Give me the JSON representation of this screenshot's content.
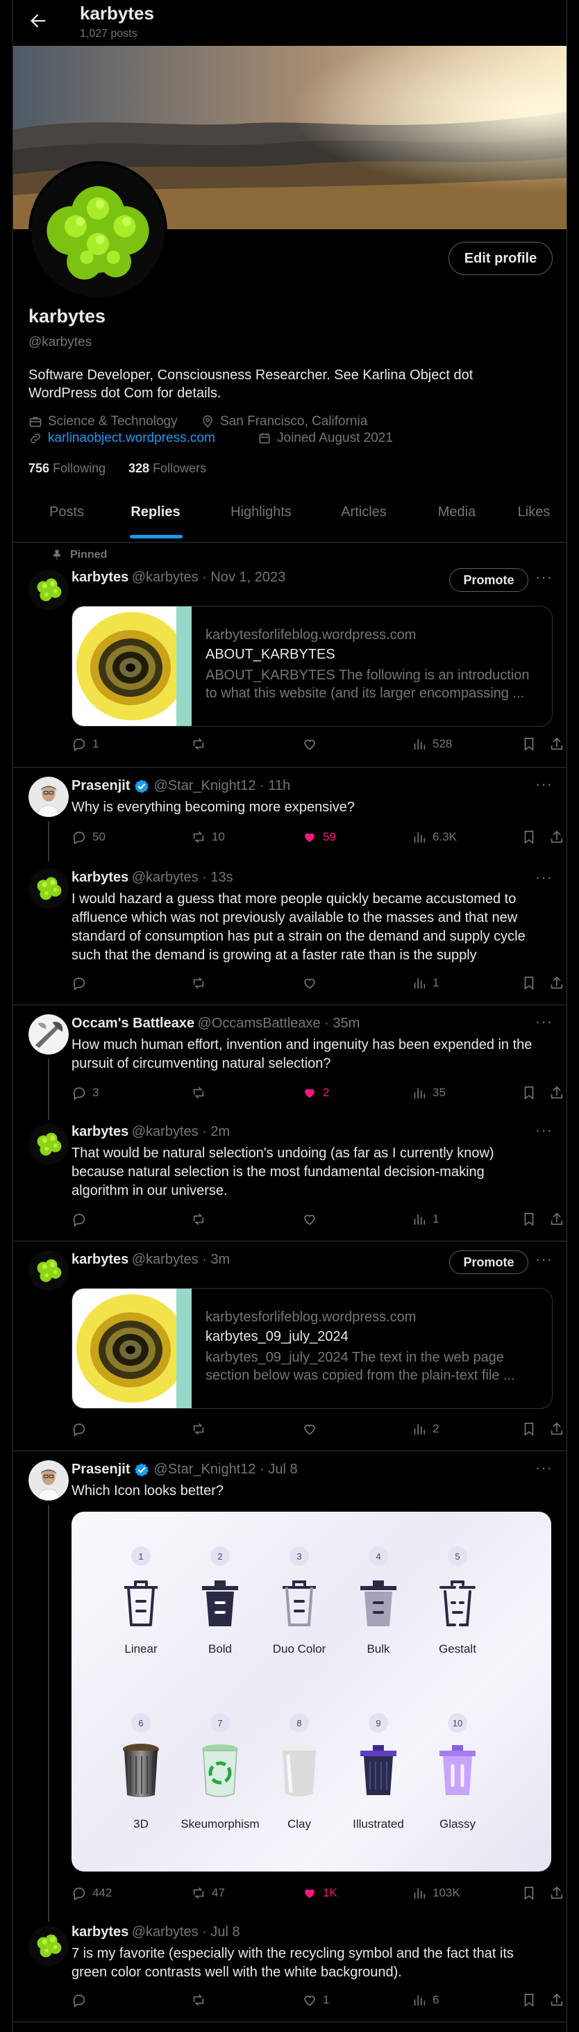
{
  "header": {
    "title": "karbytes",
    "subtitle": "1,027 posts"
  },
  "profile": {
    "name": "karbytes",
    "handle": "@karbytes",
    "edit_label": "Edit profile",
    "bio_line1": "Software Developer, Consciousness Researcher. See Karlina Object dot",
    "bio_line2": "WordPress dot Com for details.",
    "category": "Science & Technology",
    "location": "San Francisco, California",
    "website": "karlinaobject.wordpress.com",
    "joined": "Joined August 2021",
    "following_count": "756",
    "following_label": "Following",
    "followers_count": "328",
    "followers_label": "Followers"
  },
  "tabs": [
    "Posts",
    "Replies",
    "Highlights",
    "Articles",
    "Media",
    "Likes"
  ],
  "active_tab": "Replies",
  "colors": {
    "accent": "#1d9bf0",
    "like": "#f91880",
    "background": "#000000",
    "border": "#2f3336"
  },
  "posts": {
    "pinned": {
      "pinned_label": "Pinned",
      "name": "karbytes",
      "meta": "@karbytes · Nov 1, 2023",
      "promote": "Promote",
      "card_domain": "karbytesforlifeblog.wordpress.com",
      "card_title": "ABOUT_KARBYTES",
      "card_desc1": "ABOUT_KARBYTES The following is an introduction",
      "card_desc2": "to what this website (and its larger encompassing ...",
      "replies": "1",
      "views": "528"
    },
    "p1": {
      "name": "Prasenjit",
      "meta": "@Star_Knight12 · 11h",
      "text": "Why is everything becoming more expensive?",
      "replies": "50",
      "reposts": "10",
      "likes": "59",
      "views": "6.3K"
    },
    "r1": {
      "name": "karbytes",
      "meta": "@karbytes · 13s",
      "line1": "I would hazard a guess that more people quickly became accustomed to",
      "line2": "affluence which was not previously available to the masses and that new",
      "line3": "standard of consumption has put a strain on the demand and supply cycle",
      "line4": "such that the demand is growing at a faster rate than is the supply",
      "views": "1"
    },
    "p2": {
      "name": "Occam's Battleaxe",
      "meta": "@OccamsBattleaxe · 35m",
      "line1": "How much human effort, invention and ingenuity has been expended in the",
      "line2": "pursuit of circumventing natural selection?",
      "replies": "3",
      "likes": "2",
      "views": "35"
    },
    "r2": {
      "name": "karbytes",
      "meta": "@karbytes · 2m",
      "line1": "That would be natural selection's undoing (as far as I currently know)",
      "line2": "because natural selection is the most fundamental decision-making",
      "line3": "algorithm in our universe.",
      "views": "1"
    },
    "p3": {
      "name": "karbytes",
      "meta": "@karbytes · 3m",
      "promote": "Promote",
      "card_domain": "karbytesforlifeblog.wordpress.com",
      "card_title": "karbytes_09_july_2024",
      "card_desc1": "karbytes_09_july_2024 The text in the web page",
      "card_desc2": "section below was copied from the plain-text file ...",
      "views": "2"
    },
    "p4": {
      "name": "Prasenjit",
      "meta": "@Star_Knight12 · Jul 8",
      "text": "Which Icon looks better?",
      "replies": "442",
      "reposts": "47",
      "likes": "1K",
      "views": "103K",
      "icons": [
        {
          "n": "1",
          "label": "Linear"
        },
        {
          "n": "2",
          "label": "Bold"
        },
        {
          "n": "3",
          "label": "Duo Color"
        },
        {
          "n": "4",
          "label": "Bulk"
        },
        {
          "n": "5",
          "label": "Gestalt"
        },
        {
          "n": "6",
          "label": "3D"
        },
        {
          "n": "7",
          "label": "Skeumorphism"
        },
        {
          "n": "8",
          "label": "Clay"
        },
        {
          "n": "9",
          "label": "Illustrated"
        },
        {
          "n": "10",
          "label": "Glassy"
        }
      ]
    },
    "r4": {
      "name": "karbytes",
      "meta": "@karbytes · Jul 8",
      "line1": "7 is my favorite (especially with the recycling symbol and the fact that its",
      "line2": "green color contrasts well with the white background).",
      "likes": "1",
      "views": "6"
    }
  }
}
